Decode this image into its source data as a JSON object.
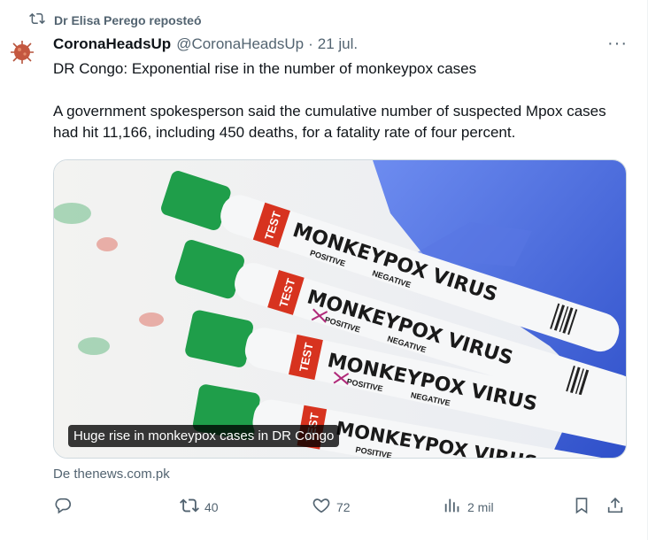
{
  "repost": {
    "label": "Dr Elisa Perego reposteó",
    "icon": "repost-icon"
  },
  "tweet": {
    "author_name": "CoronaHeadsUp",
    "author_handle": "@CoronaHeadsUp",
    "separator": "·",
    "date": "21 jul.",
    "text_line1": "DR Congo: Exponential rise in the number of monkeypox cases",
    "text_line2": "A government spokesperson said the cumulative number of  suspected Mpox cases had hit 11,166, including 450 deaths, for a fatality  rate of four percent.",
    "more_label": "···"
  },
  "media": {
    "caption": "Huge rise in monkeypox cases in DR Congo",
    "tubes": [
      {
        "brand": "TEST",
        "title": "MONKEYPOX VIRUS",
        "positive": "POSITIVE",
        "negative": "NEGATIVE"
      },
      {
        "brand": "TEST",
        "title": "MONKEYPOX VIRUS",
        "positive": "POSITIVE",
        "negative": "NEGATIVE"
      },
      {
        "brand": "TEST",
        "title": "MONKEYPOX VIRUS",
        "positive": "POSITIVE",
        "negative": "NEGATIVE"
      },
      {
        "brand": "TEST",
        "title": "MONKEYPOX VIRUS",
        "positive": "POSITIVE",
        "negative": ""
      }
    ]
  },
  "source": "De thenews.com.pk",
  "actions": {
    "reply": {
      "icon": "reply-icon",
      "count": ""
    },
    "repost": {
      "icon": "repost-icon",
      "count": "40"
    },
    "like": {
      "icon": "heart-icon",
      "count": "72"
    },
    "views": {
      "icon": "views-icon",
      "count": "2 mil"
    },
    "bookmark": {
      "icon": "bookmark-icon"
    },
    "share": {
      "icon": "share-icon"
    }
  },
  "colors": {
    "muted": "#536471",
    "text": "#0f1419",
    "tube_red": "#d7331f",
    "cap_green": "#1f9e4a",
    "glove_blue": "#4a6fe0"
  }
}
